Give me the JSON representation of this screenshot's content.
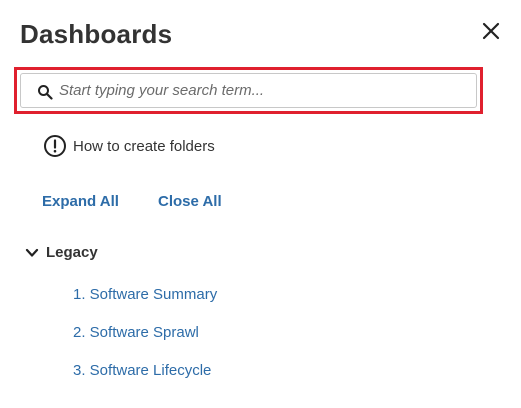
{
  "panel": {
    "title": "Dashboards",
    "close_icon": "close-icon"
  },
  "search": {
    "placeholder": "Start typing your search term...",
    "value": "",
    "icon": "search-icon",
    "highlight_color": "#e0202e"
  },
  "help": {
    "icon": "exclamation-circle-icon",
    "label": "How to create folders"
  },
  "actions": {
    "expand_all": "Expand All",
    "close_all": "Close All"
  },
  "groups": [
    {
      "label": "Legacy",
      "expanded": true,
      "icon": "chevron-down-icon",
      "items": [
        {
          "label": "1. Software Summary"
        },
        {
          "label": "2. Software Sprawl"
        },
        {
          "label": "3. Software Lifecycle"
        }
      ]
    }
  ],
  "colors": {
    "link": "#2d6ca8",
    "text": "#333333"
  }
}
